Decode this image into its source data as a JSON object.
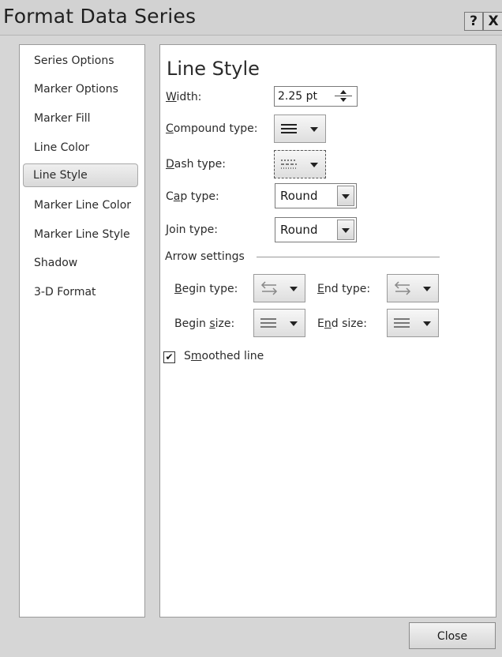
{
  "dialog": {
    "title": "Format Data Series",
    "help_label": "?",
    "close_x_label": "X",
    "close_button_label": "Close"
  },
  "nav": {
    "items": [
      {
        "label": "Series Options",
        "selected": false
      },
      {
        "label": "Marker Options",
        "selected": false
      },
      {
        "label": "Marker Fill",
        "selected": false
      },
      {
        "label": "Line Color",
        "selected": false
      },
      {
        "label": "Line Style",
        "selected": true
      },
      {
        "label": "Marker Line Color",
        "selected": false
      },
      {
        "label": "Marker Line Style",
        "selected": false
      },
      {
        "label": "Shadow",
        "selected": false
      },
      {
        "label": "3-D Format",
        "selected": false
      }
    ]
  },
  "line_style": {
    "heading": "Line Style",
    "width": {
      "label_key": "W",
      "label_rest": "idth:",
      "value": "2.25 pt"
    },
    "compound": {
      "label_key": "C",
      "label_rest": "ompound type:",
      "icon": "compound-lines-icon"
    },
    "dash": {
      "label_key": "D",
      "label_rest": "ash type:",
      "icon": "dash-lines-icon"
    },
    "cap": {
      "label_pre": "C",
      "label_key": "a",
      "label_rest": "p type:",
      "value": "Round"
    },
    "join": {
      "label_key": "J",
      "label_rest": "oin type:",
      "value": "Round"
    },
    "arrow_settings": {
      "heading": "Arrow settings",
      "begin_type": {
        "label_key": "B",
        "label_rest": "egin type:",
        "icon": "arrow-type-icon"
      },
      "end_type": {
        "label_key": "E",
        "label_rest": "nd type:",
        "icon": "arrow-type-icon"
      },
      "begin_size": {
        "label_pre": "Begin ",
        "label_key": "s",
        "label_rest": "ize:",
        "icon": "arrow-size-icon"
      },
      "end_size": {
        "label_pre": "E",
        "label_key": "n",
        "label_rest": "d size:",
        "icon": "arrow-size-icon"
      }
    },
    "smoothed": {
      "label_pre": "S",
      "label_key": "m",
      "label_rest": "oothed line",
      "checked": true
    }
  }
}
